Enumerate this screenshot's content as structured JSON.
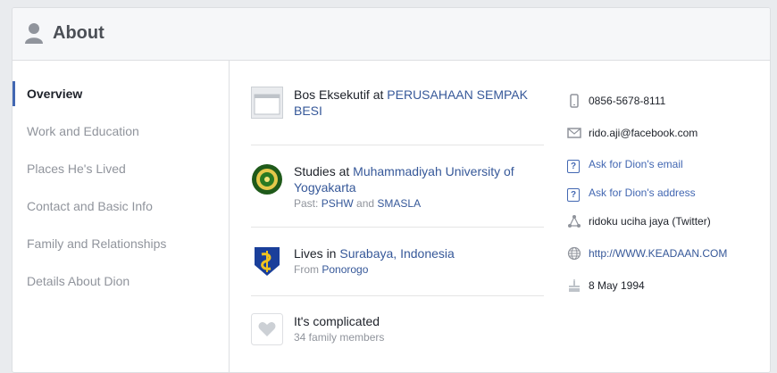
{
  "header": {
    "title": "About"
  },
  "sidebar": {
    "items": [
      {
        "label": "Overview",
        "active": true
      },
      {
        "label": "Work and Education"
      },
      {
        "label": "Places He's Lived"
      },
      {
        "label": "Contact and Basic Info"
      },
      {
        "label": "Family and Relationships"
      },
      {
        "label": "Details About Dion"
      }
    ]
  },
  "overview": {
    "work": {
      "prefix": "Bos Eksekutif at ",
      "company": "PERUSAHAAN SEMPAK BESI"
    },
    "education": {
      "prefix": "Studies at ",
      "school": "Muhammadiyah University of Yogyakarta",
      "past_prefix": "Past: ",
      "past_1": "PSHW",
      "past_and": " and ",
      "past_2": "SMASLA"
    },
    "place": {
      "prefix": "Lives in ",
      "city": "Surabaya, Indonesia",
      "from_prefix": "From ",
      "from": "Ponorogo"
    },
    "relationship": {
      "status": "It's complicated",
      "family": "34 family members"
    }
  },
  "contact": {
    "phone": "0856-5678-8111",
    "email": "rido.aji@facebook.com",
    "ask_email": "Ask for Dion's email",
    "ask_address": "Ask for Dion's address",
    "twitter_name": "ridoku uciha jaya",
    "twitter_suffix": " (Twitter)",
    "website": "http://WWW.KEADAAN.COM",
    "birthday": "8 May 1994"
  },
  "colors": {
    "link": "#365899",
    "accent": "#4267b2",
    "muted": "#90949c"
  },
  "icons": [
    "person-icon",
    "briefcase-icon",
    "school-logo-icon",
    "city-logo-icon",
    "heart-icon",
    "phone-icon",
    "mail-icon",
    "question-icon",
    "share-icon",
    "globe-icon",
    "cake-icon"
  ]
}
